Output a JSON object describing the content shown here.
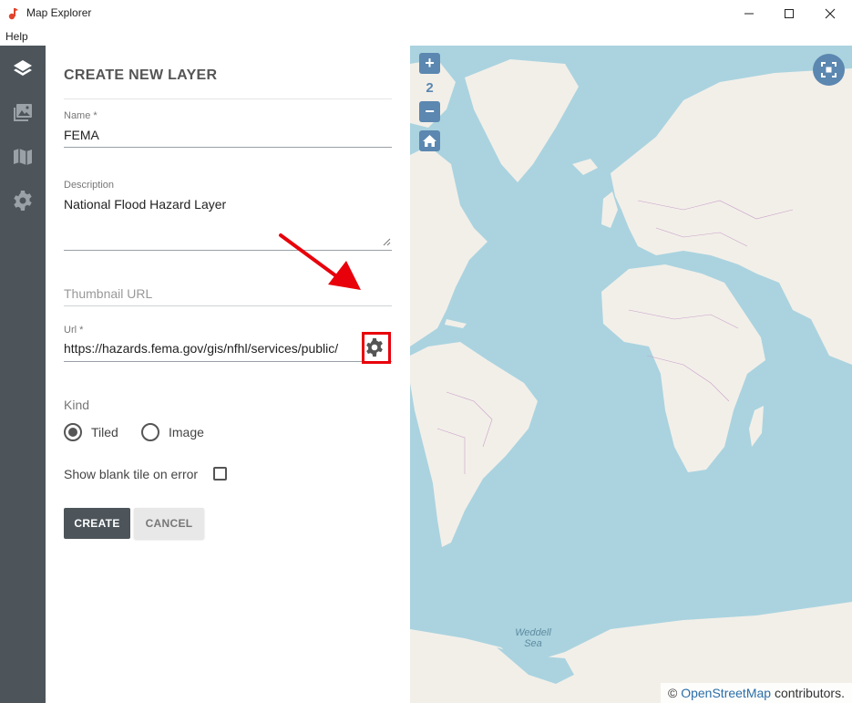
{
  "window": {
    "title": "Map Explorer"
  },
  "menu": {
    "help": "Help"
  },
  "rail": {
    "items": [
      "layers-icon",
      "images-icon",
      "map-icon",
      "settings-icon"
    ]
  },
  "form": {
    "title": "CREATE NEW LAYER",
    "name_label": "Name *",
    "name_value": "FEMA",
    "description_label": "Description",
    "description_value": "National Flood Hazard Layer",
    "thumbnail_placeholder": "Thumbnail URL",
    "url_label": "Url *",
    "url_value": "https://hazards.fema.gov/gis/nfhl/services/public/",
    "kind_label": "Kind",
    "kind_options": [
      {
        "label": "Tiled",
        "selected": true
      },
      {
        "label": "Image",
        "selected": false
      }
    ],
    "blank_tile_label": "Show blank tile on error",
    "blank_tile_checked": false,
    "create_label": "CREATE",
    "cancel_label": "CANCEL"
  },
  "map": {
    "zoom_in": "+",
    "zoom_level": "2",
    "zoom_out": "−",
    "sea_label_line1": "Weddell",
    "sea_label_line2": "Sea",
    "attribution_prefix": "© ",
    "attribution_link": "OpenStreetMap",
    "attribution_suffix": " contributors."
  },
  "colors": {
    "rail": "#4d555b",
    "water": "#aad3df",
    "land": "#f2efe9",
    "map_control": "#5b87b0",
    "highlight": "#e8000b"
  }
}
